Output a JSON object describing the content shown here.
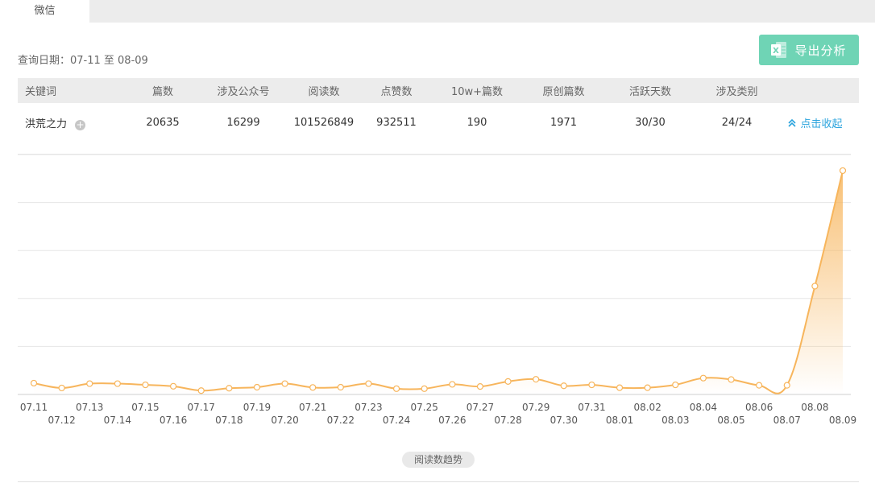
{
  "tabs": [
    {
      "label": "微信"
    }
  ],
  "query": {
    "label": "查询日期：07-11 至 08-09"
  },
  "export_button": {
    "label": "导出分析",
    "icon": "excel-icon",
    "color": "#6fd4b5"
  },
  "table": {
    "headers": [
      "关键词",
      "篇数",
      "涉及公众号",
      "阅读数",
      "点赞数",
      "10w+篇数",
      "原创篇数",
      "活跃天数",
      "涉及类别",
      ""
    ],
    "row": {
      "keyword": "洪荒之力",
      "articles": "20635",
      "accounts": "16299",
      "reads": "101526849",
      "likes": "932511",
      "over_100k": "190",
      "original": "1971",
      "active_days": "30/30",
      "categories": "24/24",
      "action": "点击收起"
    }
  },
  "chart_data": {
    "type": "area",
    "title": "",
    "xlabel": "",
    "ylabel": "",
    "line_color": "#f7b55c",
    "x": [
      "07.11",
      "07.12",
      "07.13",
      "07.14",
      "07.15",
      "07.16",
      "07.17",
      "07.18",
      "07.19",
      "07.20",
      "07.21",
      "07.22",
      "07.23",
      "07.24",
      "07.25",
      "07.26",
      "07.27",
      "07.28",
      "07.29",
      "07.30",
      "07.31",
      "08.01",
      "08.02",
      "08.03",
      "08.04",
      "08.05",
      "08.06",
      "08.07",
      "08.08",
      "08.09"
    ],
    "series": [
      {
        "values": [
          0.47,
          0.27,
          0.45,
          0.45,
          0.4,
          0.34,
          0.16,
          0.26,
          0.3,
          0.45,
          0.29,
          0.3,
          0.45,
          0.24,
          0.24,
          0.42,
          0.33,
          0.54,
          0.63,
          0.36,
          0.4,
          0.28,
          0.28,
          0.4,
          0.68,
          0.62,
          0.38,
          0.38,
          4.5,
          9.3
        ]
      }
    ],
    "ylim": [
      0,
      10
    ],
    "grid": true,
    "legend": "阅读数趋势"
  }
}
